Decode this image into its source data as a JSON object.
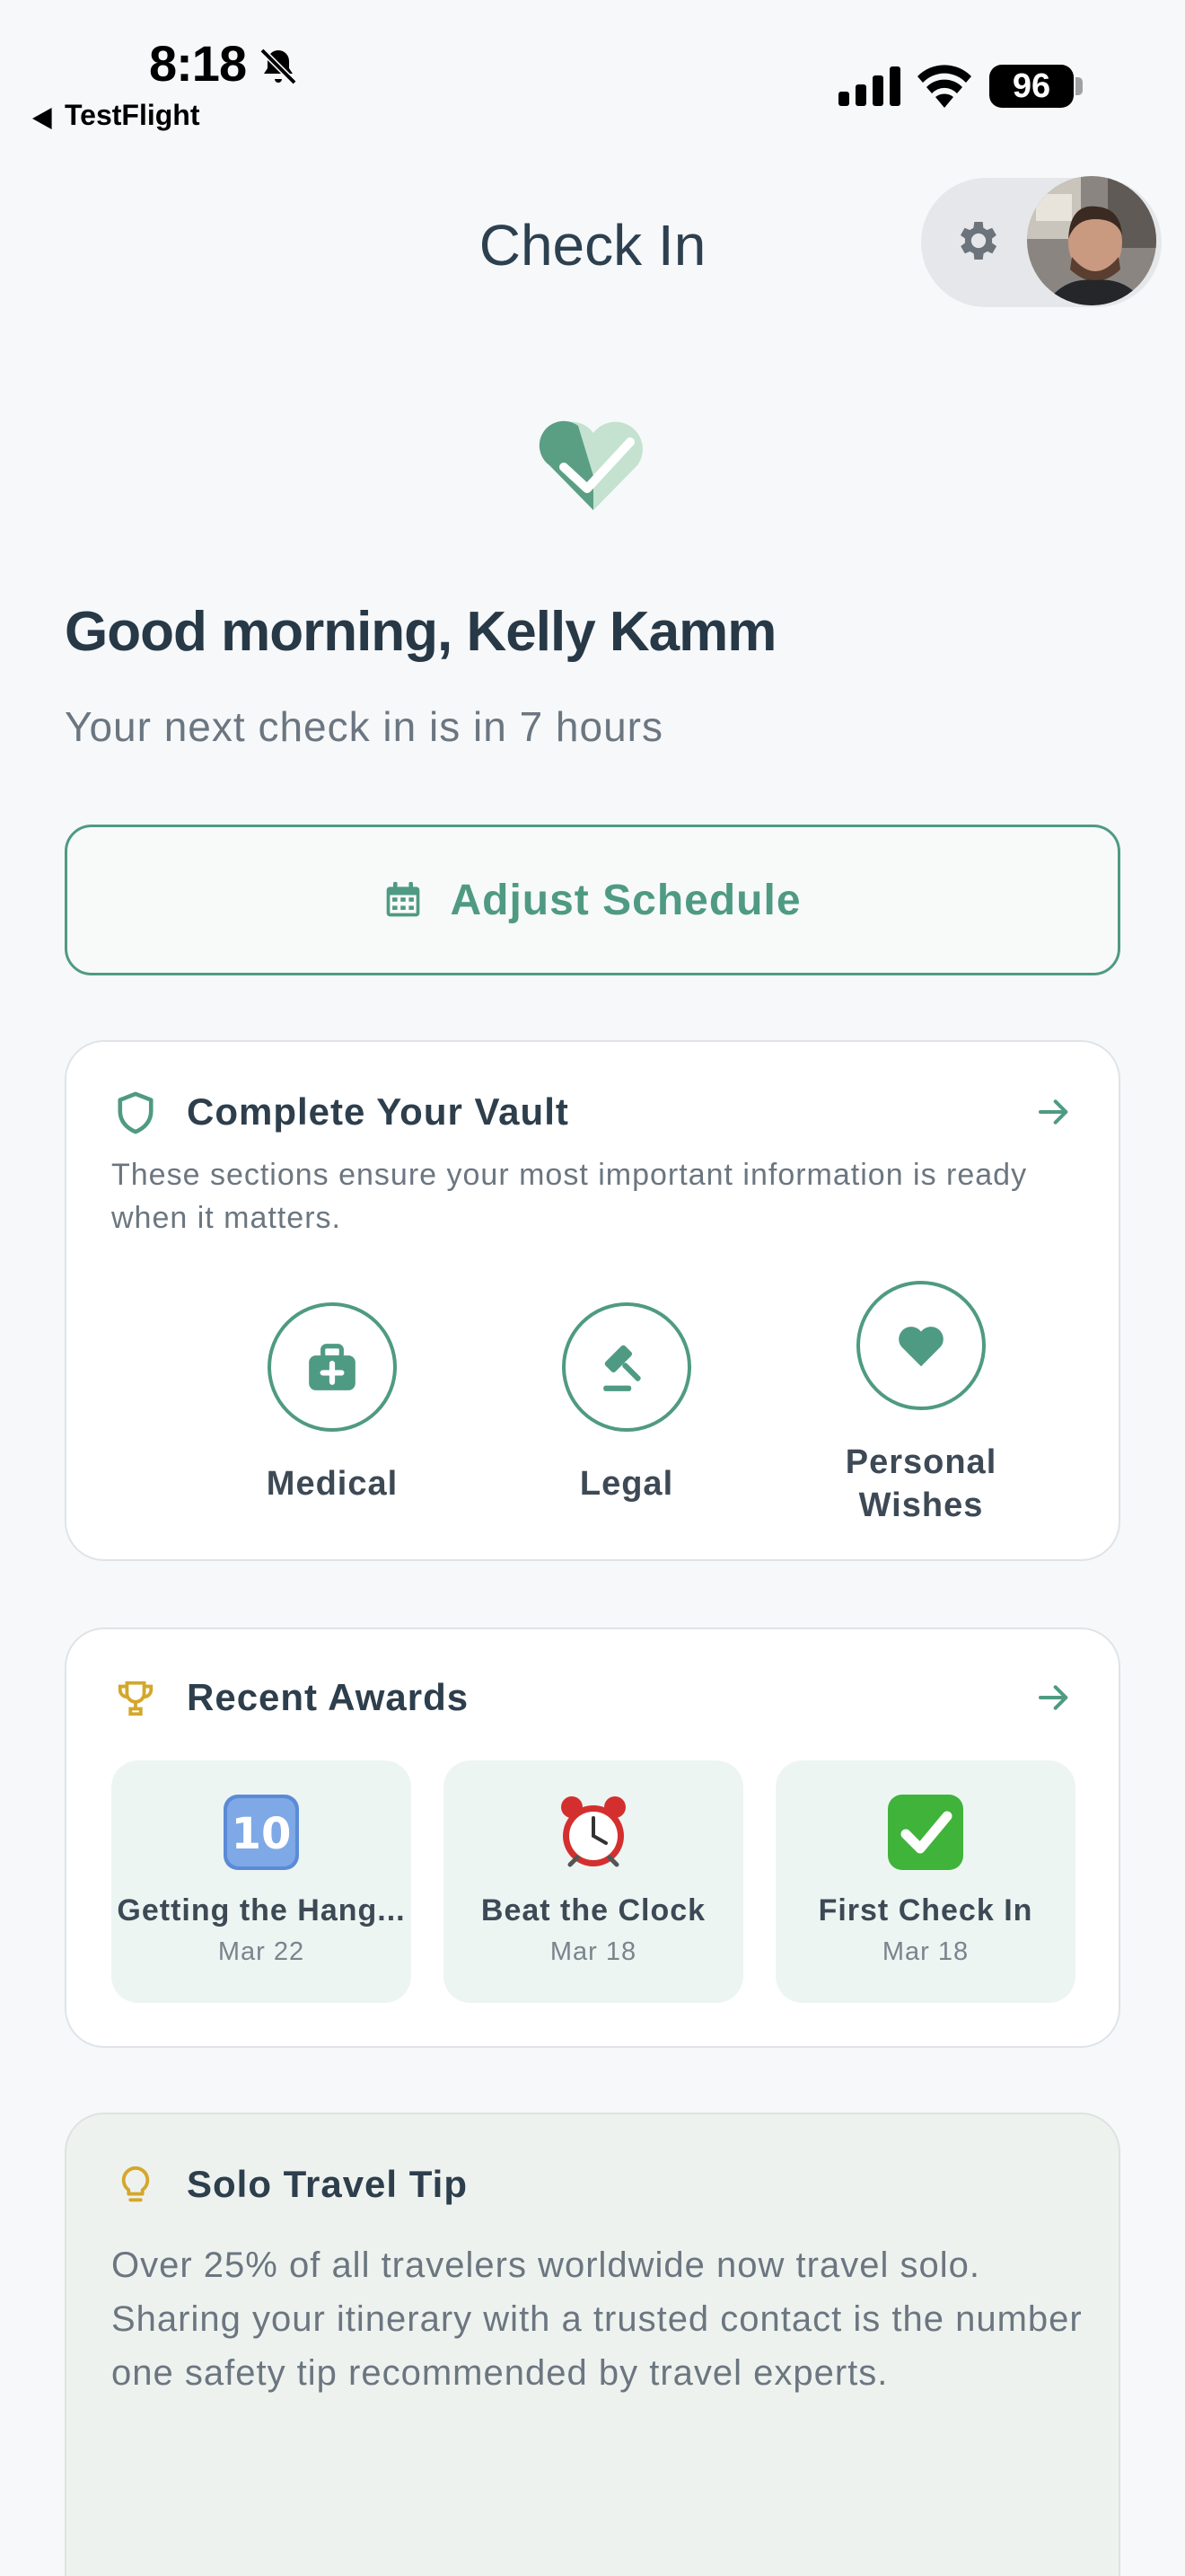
{
  "status_bar": {
    "time": "8:18",
    "back_label": "TestFlight",
    "battery": "96"
  },
  "header": {
    "title": "Check In"
  },
  "greeting": "Good morning, Kelly Kamm",
  "next_checkin": "Your next check in is in 7 hours",
  "adjust_button": {
    "label": "Adjust Schedule"
  },
  "vault": {
    "title": "Complete Your Vault",
    "description": "These sections ensure your most important information is ready when it matters.",
    "items": [
      {
        "label": "Medical",
        "icon": "medical-kit-icon"
      },
      {
        "label": "Legal",
        "icon": "gavel-icon"
      },
      {
        "label": "Personal Wishes",
        "icon": "heart-icon"
      }
    ]
  },
  "awards": {
    "title": "Recent Awards",
    "items": [
      {
        "emoji": "keycap-ten",
        "name": "Getting the Hang...",
        "date": "Mar 22"
      },
      {
        "emoji": "alarm-clock",
        "name": "Beat the Clock",
        "date": "Mar 18"
      },
      {
        "emoji": "check-mark-button",
        "name": "First Check In",
        "date": "Mar 18"
      }
    ]
  },
  "tip": {
    "title": "Solo Travel Tip",
    "text": "Over 25% of all travelers worldwide now travel solo. Sharing your itinerary with a trusted contact is the number one safety tip recommended by travel experts."
  },
  "colors": {
    "accent": "#4f9a83",
    "background": "#f6f8fa",
    "award_tile": "#edf5f3",
    "tip_background": "#eef2ef"
  }
}
